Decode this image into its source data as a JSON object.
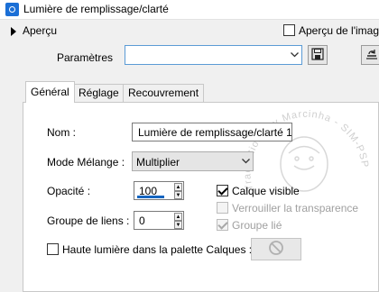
{
  "window": {
    "title": "Lumière de remplissage/clarté"
  },
  "apercu": {
    "toggle_label": "Aperçu",
    "checkbox_label": "Aperçu de l'image",
    "checked": false
  },
  "parametres": {
    "label": "Paramètres",
    "value": ""
  },
  "tabs": [
    {
      "label": "Général",
      "active": true
    },
    {
      "label": "Réglage",
      "active": false
    },
    {
      "label": "Recouvrement",
      "active": false
    }
  ],
  "general": {
    "nom_label": "Nom :",
    "nom_value": "Lumière de remplissage/clarté 1",
    "mode_label": "Mode Mélange :",
    "mode_value": "Multiplier",
    "opacite_label": "Opacité :",
    "opacite_value": "100",
    "groupe_label": "Groupe de liens :",
    "groupe_value": "0",
    "calque_visible_label": "Calque visible",
    "calque_visible_checked": true,
    "verrouiller_label": "Verrouiller la transparence",
    "verrouiller_checked": false,
    "groupe_lie_label": "Groupe lié",
    "groupe_lie_checked": true,
    "haute_lumiere_label": "Haute lumière dans la palette Calques :",
    "haute_lumiere_checked": false
  },
  "watermark": {
    "text": "Traductions by Marcinha - SIM-PSP"
  },
  "colors": {
    "accent": "#1565c0",
    "title_icon": "#1b6fd6"
  },
  "icons": [
    "app-icon",
    "expand-triangle-icon",
    "chevron-down-icon",
    "save-icon",
    "reset-icon",
    "no-icon"
  ]
}
